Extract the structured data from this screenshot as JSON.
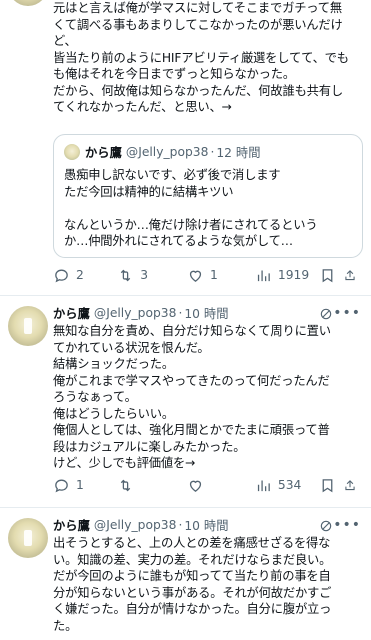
{
  "tweets": [
    {
      "body": "元はと言えば俺が学マスに対してそこまでガチって無\nくて調べる事もあまりしてこなかったのが悪いんだけ\nど、\n皆当たり前のようにHIFアビリティ厳選をしてて、でも\nも俺はそれを今日までずっと知らなかった。\nだから、何故俺は知らなかったんだ、何故誰も共有し\nてくれなかったんだ、と思い、→",
      "quote": {
        "name": "から鷹",
        "handle": "@Jelly_pop38",
        "dot": "·",
        "time": "12 時間",
        "body": "愚痴申し訳ないです、必ず後で消します\nただ今回は精神的に結構キツい\n\nなんというか…俺だけ除け者にされてるという\nか…仲間外れにされてるような気がして…"
      },
      "actions": {
        "replies": "2",
        "retweets": "3",
        "likes": "1",
        "views": "1919"
      }
    },
    {
      "name": "から鷹",
      "handle": "@Jelly_pop38",
      "dot": "·",
      "time": "10 時間",
      "body": "無知な自分を責め、自分だけ知らなくて周りに置い\nてかれている状況を恨んだ。\n結構ショックだった。\n俺がこれまで学マスやってきたのって何だったんだ\nろうなぁって。\n俺はどうしたらいい。\n俺個人としては、強化月間とかでたまに頑張って普\n段はカジュアルに楽しみたかった。\nけど、少しでも評価値を→",
      "actions": {
        "replies": "1",
        "retweets": "",
        "likes": "",
        "views": "534"
      }
    },
    {
      "name": "から鷹",
      "handle": "@Jelly_pop38",
      "dot": "·",
      "time": "10 時間",
      "body": "出そうとすると、上の人との差を痛感せざるを得な\nい。知識の差、実力の差。それだけならまだ良い。\nだが今回のように誰もが知ってて当たり前の事を自\n分が知らないという事がある。それが何故だかすご\nく嫌だった。自分が情けなかった。自分に腹が立っ\nた。"
    }
  ],
  "icons": {
    "reply": "reply-icon",
    "retweet": "retweet-icon",
    "like": "heart-icon",
    "views": "views-chart-icon",
    "bookmark": "bookmark-icon",
    "share": "share-icon",
    "grok": "grok-icon",
    "more": "more-icon"
  }
}
